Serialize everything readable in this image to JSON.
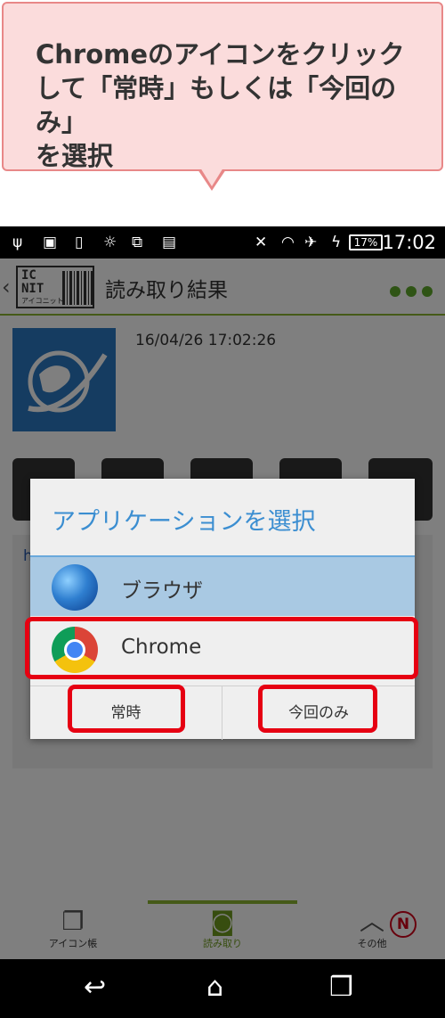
{
  "callout": {
    "line1": "Chromeのアイコンをクリック",
    "line2": "して「常時」もしくは「今回のみ」",
    "line3": "を選択"
  },
  "statusbar": {
    "time": "17:02",
    "battery": "17%"
  },
  "appbar": {
    "logo_top": "IC",
    "logo_mid": "NIT",
    "logo_sub": "アイコニット",
    "title": "読み取り結果"
  },
  "content": {
    "timestamp": "16/04/26 17:02:26",
    "link_prefix": "h"
  },
  "dialog": {
    "title": "アプリケーションを選択",
    "options": [
      {
        "label": "ブラウザ",
        "icon": "globe-icon"
      },
      {
        "label": "Chrome",
        "icon": "chrome-icon"
      }
    ],
    "always_label": "常時",
    "just_once_label": "今回のみ"
  },
  "bottomnav": {
    "items": [
      {
        "label": "アイコン帳",
        "icon": "cards-icon"
      },
      {
        "label": "読み取り",
        "icon": "camera-icon"
      },
      {
        "label": "その他",
        "icon": "chevron-up-icon"
      }
    ],
    "badge": "N"
  },
  "colors": {
    "accent_green": "#8bb430",
    "dialog_title_blue": "#3b8ed1",
    "highlight_red": "#e60012",
    "callout_bg": "#fbdcdc"
  }
}
